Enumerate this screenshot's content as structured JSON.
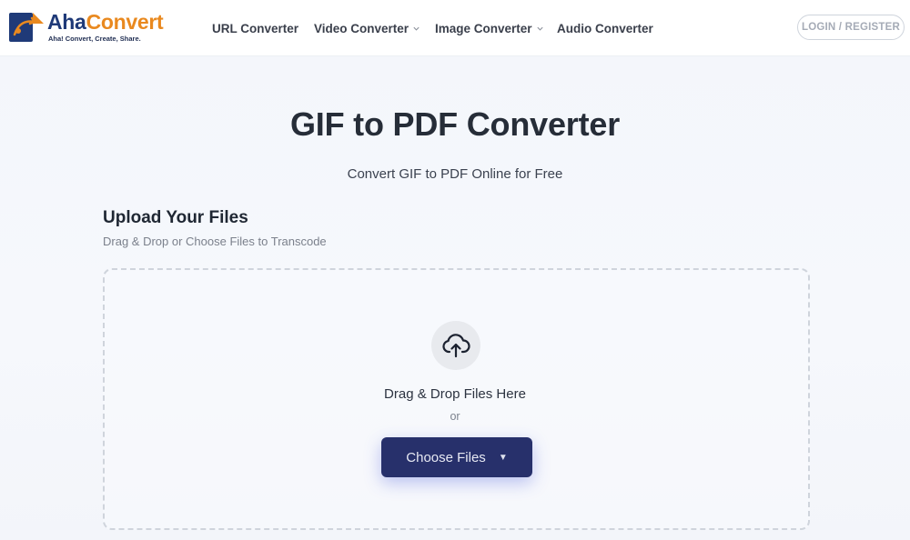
{
  "brand": {
    "name_part1": "Aha",
    "name_part2": "Convert",
    "tagline": "Aha! Convert, Create, Share."
  },
  "nav": {
    "items": [
      {
        "label": "URL Converter",
        "has_dropdown": false
      },
      {
        "label": "Video Converter",
        "has_dropdown": true
      },
      {
        "label": "Image Converter",
        "has_dropdown": true
      },
      {
        "label": "Audio Converter",
        "has_dropdown": false
      }
    ],
    "login_label": "LOGIN / REGISTER"
  },
  "hero": {
    "title": "GIF to PDF Converter",
    "subtitle": "Convert GIF to PDF Online for Free"
  },
  "upload": {
    "heading": "Upload Your Files",
    "subheading": "Drag & Drop or Choose Files to Transcode",
    "drop_text": "Drag & Drop Files Here",
    "or_text": "or",
    "button_label": "Choose Files",
    "button_caret": "▼"
  },
  "icons": {
    "upload": "cloud-upload-icon",
    "dropdown": "chevron-down-icon",
    "logo": "ahaconvert-logo-icon"
  },
  "colors": {
    "brand_blue": "#1f3a78",
    "brand_orange": "#e9891f",
    "button_bg": "#27306b"
  }
}
